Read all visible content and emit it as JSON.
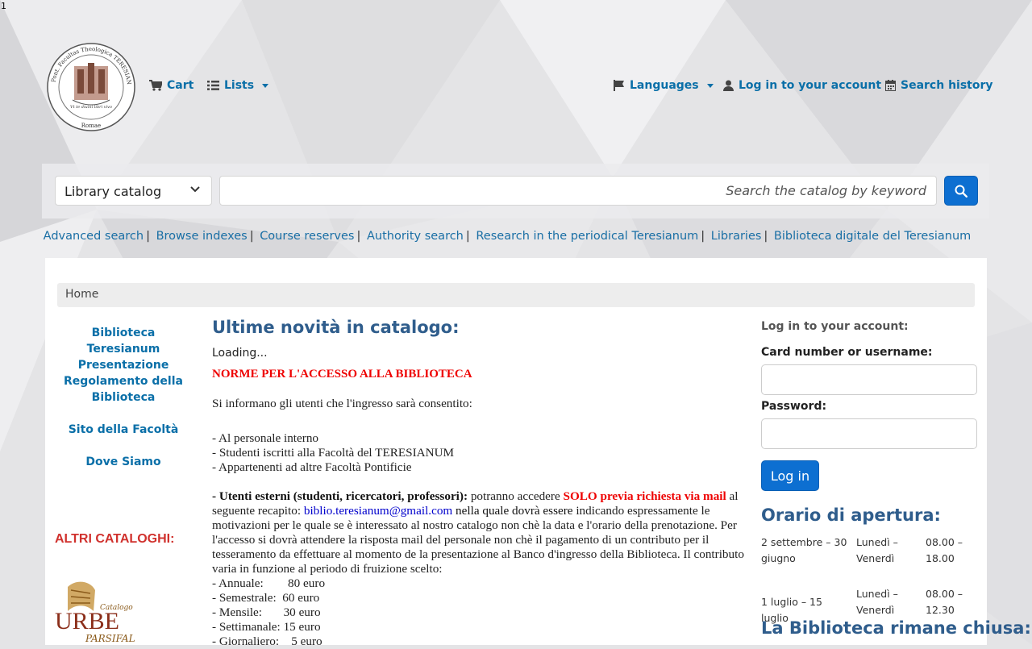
{
  "corner_number": "1",
  "header": {
    "cart": "Cart",
    "lists": "Lists",
    "languages": "Languages",
    "login": "Log in to your account",
    "search_history": "Search history",
    "logo_text": "Pont. Facultas Theologica TERESIANUM Pont. Inst. Spiritualitatis Romae",
    "logo_motto": "Vt te diuini libri vivo"
  },
  "search": {
    "select_value": "Library catalog",
    "placeholder": "Search the catalog by keyword"
  },
  "moresearches": [
    "Advanced search",
    "Browse indexes",
    "Course reserves",
    "Authority search",
    "Research in the periodical Teresianum",
    "Libraries",
    "Biblioteca digitale del Teresianum"
  ],
  "breadcrumb": "Home",
  "leftnav": {
    "items": [
      "Biblioteca Teresianum Presentazione",
      "Regolamento della Biblioteca",
      "Sito della Facoltà",
      "Dove Siamo"
    ],
    "altri_cataloghi": "ALTRI CATALOGHI:",
    "urbe_logo": {
      "catalogo": "Catalogo",
      "urbe": "URBE",
      "parsifal": "PARSIFAL"
    }
  },
  "news": {
    "title": "Ultime novità in catalogo:",
    "loading": "Loading..."
  },
  "notice": {
    "title": "NORME PER L'ACCESSO ALLA BIBLIOTECA",
    "intro": "Si informano gli utenti che l'ingresso sarà consentito:",
    "list": [
      "- Al personale interno",
      "- Studenti iscritti alla Facoltà del TERESIANUM",
      "- Appartenenti ad altre Facoltà Pontificie"
    ],
    "ext_label": "- Utenti esterni (studenti, ricercatori, professori):",
    "ext_t1": " potranno accedere ",
    "ext_red": "SOLO previa richiesta via mail",
    "ext_t2": " al seguente recapito: ",
    "email": "biblio.teresianum@gmail.com",
    "ext_t3": "  nella quale dovrà essere",
    "ext_t4": " indicando espressamente le motivazioni per le quale se è interessato al nostro catalogo non chè la data e l'orario della prenotazione. Per l'accesso si dovrà attendere la risposta mail del personale non chè il pagamento di un contributo per il tesseramento da effettuare al momento de la presentazione al Banco d'ingresso della Biblioteca. Il contributo varia in funzione al periodo di fruizione scelto:",
    "fees": [
      "- Annuale:        80 euro",
      "- Semestrale:  60 euro",
      "- Mensile:       30 euro",
      "- Settimanale: 15 euro",
      "- Giornaliero:    5 euro"
    ]
  },
  "login": {
    "heading": "Log in to your account:",
    "user_label": "Card number or username:",
    "pass_label": "Password:",
    "button": "Log in"
  },
  "orario": {
    "title": "Orario di apertura:",
    "rows": [
      {
        "period": "2 settembre – 30 giugno",
        "days": "Lunedì – Venerdì",
        "hours": "08.00 – 18.00"
      },
      {
        "period": "1 luglio – 15 luglio",
        "days": "Lunedì – Venerdì",
        "hours": "08.00 – 12.30"
      }
    ],
    "closed_title": "La Biblioteca rimane chiusa:"
  },
  "colors": {
    "link": "#0a6fa8",
    "heading": "#2f5d8c",
    "button": "#0d6fd1",
    "alert_red": "#e00000"
  }
}
